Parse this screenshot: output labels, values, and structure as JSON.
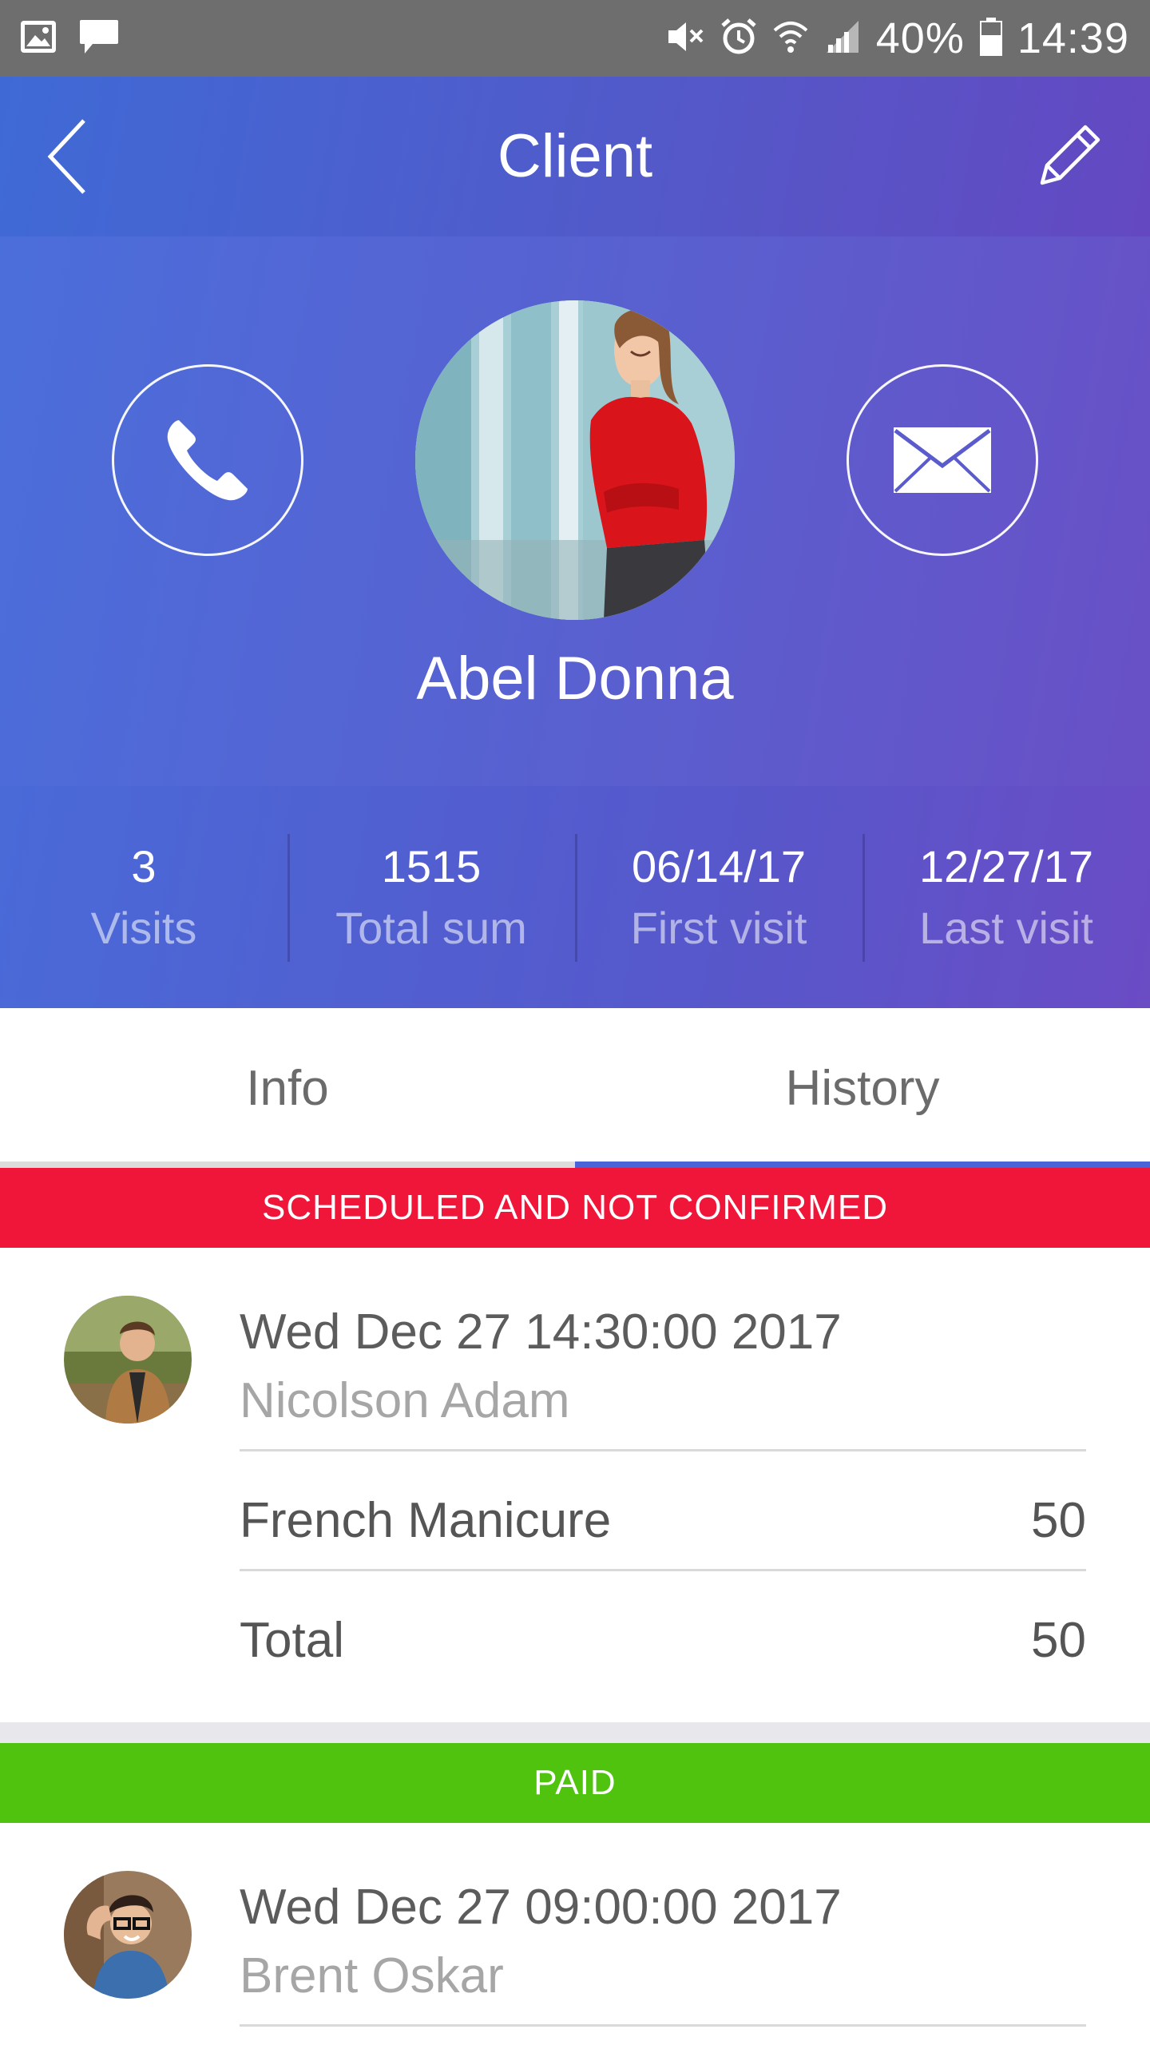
{
  "status_bar": {
    "battery": "40%",
    "time": "14:39",
    "icons_left": [
      "image-icon",
      "message-icon"
    ],
    "icons_right": [
      "mute-icon",
      "alarm-icon",
      "wifi-icon",
      "signal-icon",
      "battery-icon"
    ]
  },
  "header": {
    "title": "Client",
    "back_icon": "chevron-left-icon",
    "edit_icon": "pencil-icon"
  },
  "client": {
    "name": "Abel Donna",
    "call_icon": "phone-icon",
    "mail_icon": "envelope-icon"
  },
  "stats": [
    {
      "value": "3",
      "label": "Visits"
    },
    {
      "value": "1515",
      "label": "Total sum"
    },
    {
      "value": "06/14/17",
      "label": "First visit"
    },
    {
      "value": "12/27/17",
      "label": "Last visit"
    }
  ],
  "tabs": [
    {
      "label": "Info",
      "active": false
    },
    {
      "label": "History",
      "active": true
    }
  ],
  "appointments": [
    {
      "status": "SCHEDULED AND NOT CONFIRMED",
      "status_color": "#f0163a",
      "date": "Wed Dec 27 14:30:00 2017",
      "staff": "Nicolson Adam",
      "services": [
        {
          "name": "French Manicure",
          "price": "50"
        }
      ],
      "total_label": "Total",
      "total": "50"
    },
    {
      "status": "PAID",
      "status_color": "#50c30f",
      "date": "Wed Dec 27 09:00:00 2017",
      "staff": "Brent Oskar"
    }
  ],
  "colors": {
    "accent": "#4a63d6",
    "gradient_start": "#4a6fdb",
    "gradient_end": "#6a4fc6"
  }
}
